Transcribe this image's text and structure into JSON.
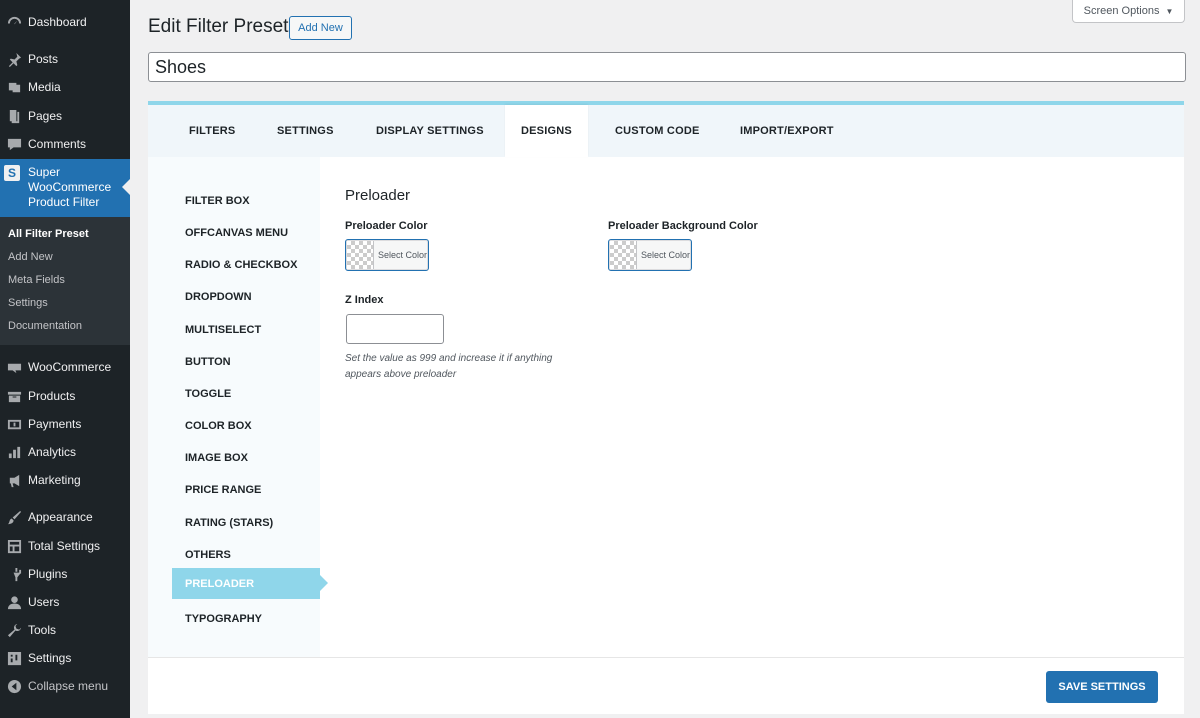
{
  "sidebar": {
    "dashboard": "Dashboard",
    "posts": "Posts",
    "media": "Media",
    "pages": "Pages",
    "comments": "Comments",
    "plugin_letter": "S",
    "plugin": "Super WooCommerce Product Filter",
    "submenu": {
      "all_filter_preset": "All Filter Preset",
      "add_new": "Add New",
      "meta_fields": "Meta Fields",
      "settings": "Settings",
      "documentation": "Documentation"
    },
    "woocommerce": "WooCommerce",
    "products": "Products",
    "payments": "Payments",
    "analytics": "Analytics",
    "marketing": "Marketing",
    "appearance": "Appearance",
    "total_settings": "Total Settings",
    "plugins": "Plugins",
    "users": "Users",
    "tools": "Tools",
    "settings": "Settings",
    "collapse": "Collapse menu"
  },
  "header": {
    "screen_options": "Screen Options",
    "screen_options_arrow": "▼",
    "title": "Edit Filter Preset",
    "add_new": "Add New",
    "preset_name": "Shoes"
  },
  "tabs": {
    "filters": "FILTERS",
    "settings": "SETTINGS",
    "display_settings": "DISPLAY SETTINGS",
    "designs": "DESIGNS",
    "custom_code": "CUSTOM CODE",
    "import_export": "IMPORT/EXPORT",
    "active": "DESIGNS"
  },
  "design_nav": {
    "filter_box": "FILTER BOX",
    "offcanvas_menu": "OFFCANVAS MENU",
    "radio_checkbox": "RADIO & CHECKBOX",
    "dropdown": "DROPDOWN",
    "multiselect": "MULTISELECT",
    "button": "BUTTON",
    "toggle": "TOGGLE",
    "color_box": "COLOR BOX",
    "image_box": "IMAGE BOX",
    "price_range": "PRICE RANGE",
    "rating_stars": "RATING (STARS)",
    "others": "OTHERS",
    "preloader": "PRELOADER",
    "typography": "TYPOGRAPHY",
    "active": "PRELOADER"
  },
  "preloader": {
    "title": "Preloader",
    "color_label": "Preloader Color",
    "color_button": "Select Color",
    "bg_color_label": "Preloader Background Color",
    "bg_color_button": "Select Color",
    "z_index_label": "Z Index",
    "z_index_value": "",
    "z_index_help": "Set the value as 999 and increase it if anything appears above preloader"
  },
  "footer": {
    "save": "SAVE SETTINGS"
  },
  "colors": {
    "sidebar_bg": "#1d2327",
    "accent": "#2271b1",
    "preset_accent": "#8fd6ea"
  }
}
